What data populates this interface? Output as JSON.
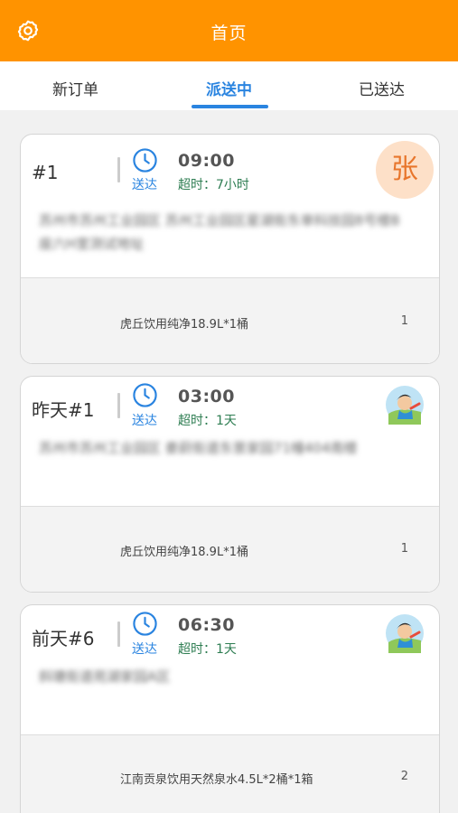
{
  "header": {
    "title": "首页",
    "settings_icon": "gear-icon"
  },
  "tabs": [
    {
      "label": "新订单",
      "active": false
    },
    {
      "label": "派送中",
      "active": true
    },
    {
      "label": "已送达",
      "active": false
    }
  ],
  "orders": [
    {
      "seq": "#1",
      "status": "送达",
      "time": "09:00",
      "overdue": "超时：7小时",
      "avatar_text": "张",
      "address": "苏州市苏州工业园区 苏州工业园区星湖街东单科技园8号楼B座六H室测试地址",
      "item": "虎丘饮用纯净18.9L*1桶",
      "qty": "1"
    },
    {
      "seq": "昨天#1",
      "status": "送达",
      "time": "03:00",
      "overdue": "超时：1天",
      "address": "苏州市苏州工业园区 娄葑街道东景家园71幢404南楼",
      "item": "虎丘饮用纯净18.9L*1桶",
      "qty": "1"
    },
    {
      "seq": "前天#6",
      "status": "送达",
      "time": "06:30",
      "overdue": "超时：1天",
      "address": "斜塘街道苑湖家园A区",
      "item": "江南贡泉饮用天然泉水4.5L*2桶*1箱",
      "qty": "2"
    }
  ],
  "colors": {
    "header": "#ff9300",
    "accent": "#2a84e0",
    "overdue": "#2e7d52"
  }
}
